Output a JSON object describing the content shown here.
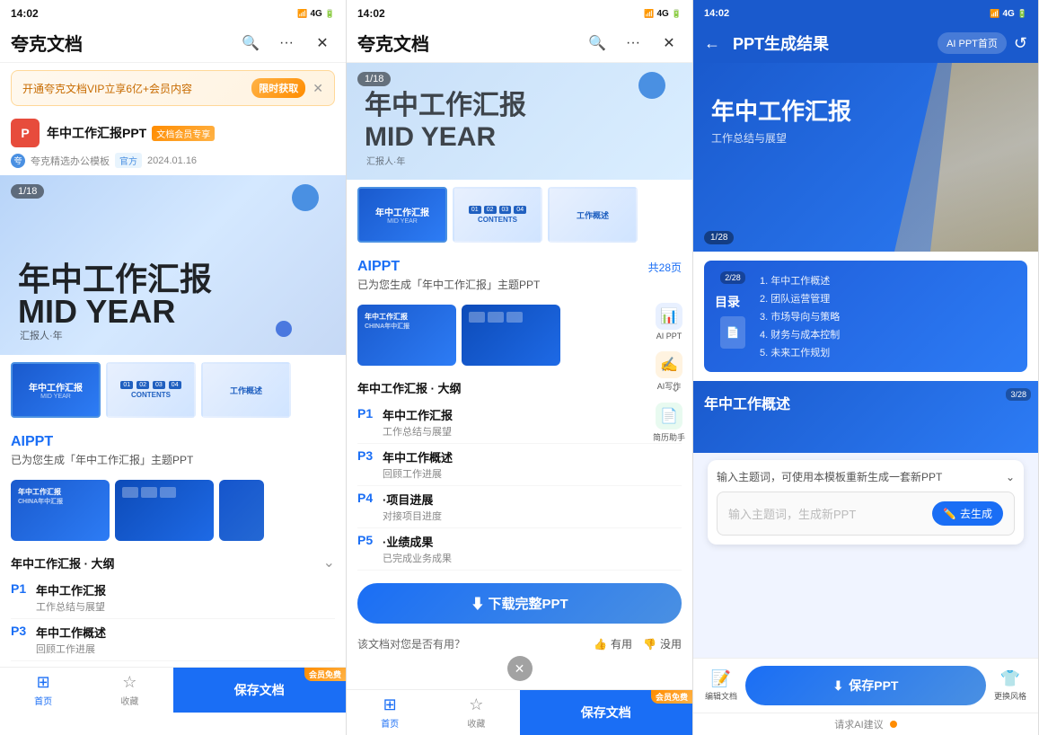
{
  "app": {
    "name": "夸克文档",
    "time": "14:02"
  },
  "panel1": {
    "status_time": "14:02",
    "title": "夸克文档",
    "promo": {
      "text": "开通夸克文档VIP立享6亿+会员内容",
      "btn": "限时获取"
    },
    "doc": {
      "icon": "P",
      "name": "年中工作汇报PPT",
      "badge1": "v",
      "badge1_text": "文档会员专享",
      "sub_icon": "夸",
      "sub_name": "夸克精选办公模板",
      "sub_official": "官方",
      "sub_date": "2024.01.16"
    },
    "preview": {
      "slide_num": "1/18",
      "mid_year": "MID YEAR",
      "subtitle": "汇报人·年"
    },
    "thumbnails": [
      {
        "label": "MID YEAR",
        "type": "blue"
      },
      {
        "label": "CONTENTS",
        "type": "light"
      },
      {
        "label": "工作概述",
        "type": "light"
      }
    ],
    "aippt": {
      "title": "AIPPT",
      "desc": "已为您生成「年中工作汇报」主题PPT"
    },
    "outline": {
      "title": "年中工作汇报 · 大纲",
      "items": [
        {
          "page": "P1",
          "title": "年中工作汇报",
          "sub": "工作总结与展望"
        },
        {
          "page": "P3",
          "title": "年中工作概述",
          "sub": "回顾工作进展"
        },
        {
          "page": "P4",
          "title": "·项目进展",
          "sub": "对接项目进度"
        },
        {
          "page": "P5",
          "title": "·业绩成果",
          "sub": "已完成业务成果"
        }
      ]
    },
    "bottom": {
      "home": "首页",
      "collect": "收藏",
      "save": "保存文档",
      "vip": "会员免费"
    }
  },
  "panel2": {
    "status_time": "14:02",
    "title": "夸克文档",
    "preview": {
      "slide_num": "1/18"
    },
    "thumbnails": [
      {
        "label": "MID YEAR",
        "type": "blue"
      },
      {
        "label": "CONTENTS",
        "type": "light"
      },
      {
        "label": "工作概述",
        "type": "light"
      }
    ],
    "aippt": {
      "title": "AIPPT",
      "desc": "已为您生成「年中工作汇报」主题PPT",
      "count": "共28页"
    },
    "tools": [
      {
        "icon": "📊",
        "label": "AI PPT",
        "type": "blue"
      },
      {
        "icon": "✍️",
        "label": "AI写作",
        "type": "orange"
      },
      {
        "icon": "📄",
        "label": "简历助手",
        "type": "green"
      }
    ],
    "outline": {
      "title": "年中工作汇报 · 大纲",
      "items": [
        {
          "page": "P1",
          "title": "年中工作汇报",
          "sub": "工作总结与展望"
        },
        {
          "page": "P3",
          "title": "年中工作概述",
          "sub": "回顾工作进展"
        },
        {
          "page": "P4",
          "title": "·项目进展",
          "sub": "对接项目进度"
        },
        {
          "page": "P5",
          "title": "·业绩成果",
          "sub": "已完成业务成果"
        }
      ]
    },
    "download": {
      "label": "⬇ 下载完整PPT"
    },
    "feedback": {
      "question": "该文档对您是否有用？",
      "useful": "有用",
      "useless": "没用"
    },
    "bottom": {
      "home": "首页",
      "collect": "收藏",
      "save": "保存文档",
      "vip": "会员免费"
    }
  },
  "panel3": {
    "status_time": "14:02",
    "back": "←",
    "title": "PPT生成结果",
    "nav_btn": "AI PPT首页",
    "slides": [
      {
        "num": "1/28",
        "title": "年中工作汇报",
        "sub": "工作总结与展望"
      },
      {
        "num": "2/28"
      },
      {
        "num": "3/28",
        "title": "年中工作概述"
      }
    ],
    "toc": {
      "title": "目录",
      "slide_num": "2/28",
      "items": [
        "1. 年中工作概述",
        "2. 团队运营管理",
        "3. 市场导向与策略",
        "4. 财务与成本控制",
        "5. 未来工作规划"
      ]
    },
    "input_card": {
      "placeholder": "输入主题词，生成新PPT",
      "hint": "输入主题词，可使用本模板重新生成一套新PPT",
      "gen_btn": "去生成"
    },
    "actions": {
      "edit": "编辑文档",
      "save": "保存PPT",
      "change": "更换风格"
    },
    "more_btn": "请求AI建议"
  }
}
